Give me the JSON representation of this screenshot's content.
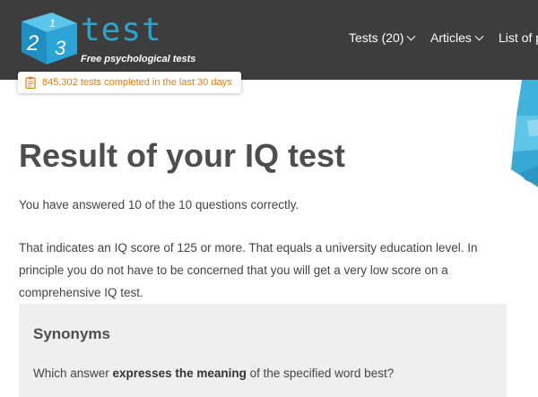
{
  "header": {
    "brand": "test",
    "tagline": "Free psychological tests",
    "logo_digits": [
      "1",
      "2",
      "3"
    ],
    "nav": [
      {
        "label": "Tests (20)",
        "icon": "chevron-down-icon"
      },
      {
        "label": "Articles",
        "icon": "chevron-down-icon"
      },
      {
        "label": "List of p",
        "icon": null
      }
    ],
    "counter": {
      "text": "845,302 tests completed in the last 30 days",
      "icon": "clipboard-icon"
    }
  },
  "main": {
    "title": "Result of your IQ test",
    "answered": "You have answered 10 of the 10 questions correctly.",
    "result": "That indicates an IQ score of 125 or more. That equals a university education level. In principle you do not have to be concerned that you will get a very low score on a comprehensive IQ test."
  },
  "card": {
    "title": "Synonyms",
    "question_pre": "Which answer ",
    "question_bold": "expresses the meaning",
    "question_post": " of the specified word best?"
  },
  "colors": {
    "header_bg": "#3d3d3d",
    "brand": "#2fa3cf",
    "counter_text": "#e07d10",
    "card_bg": "#efefef"
  }
}
